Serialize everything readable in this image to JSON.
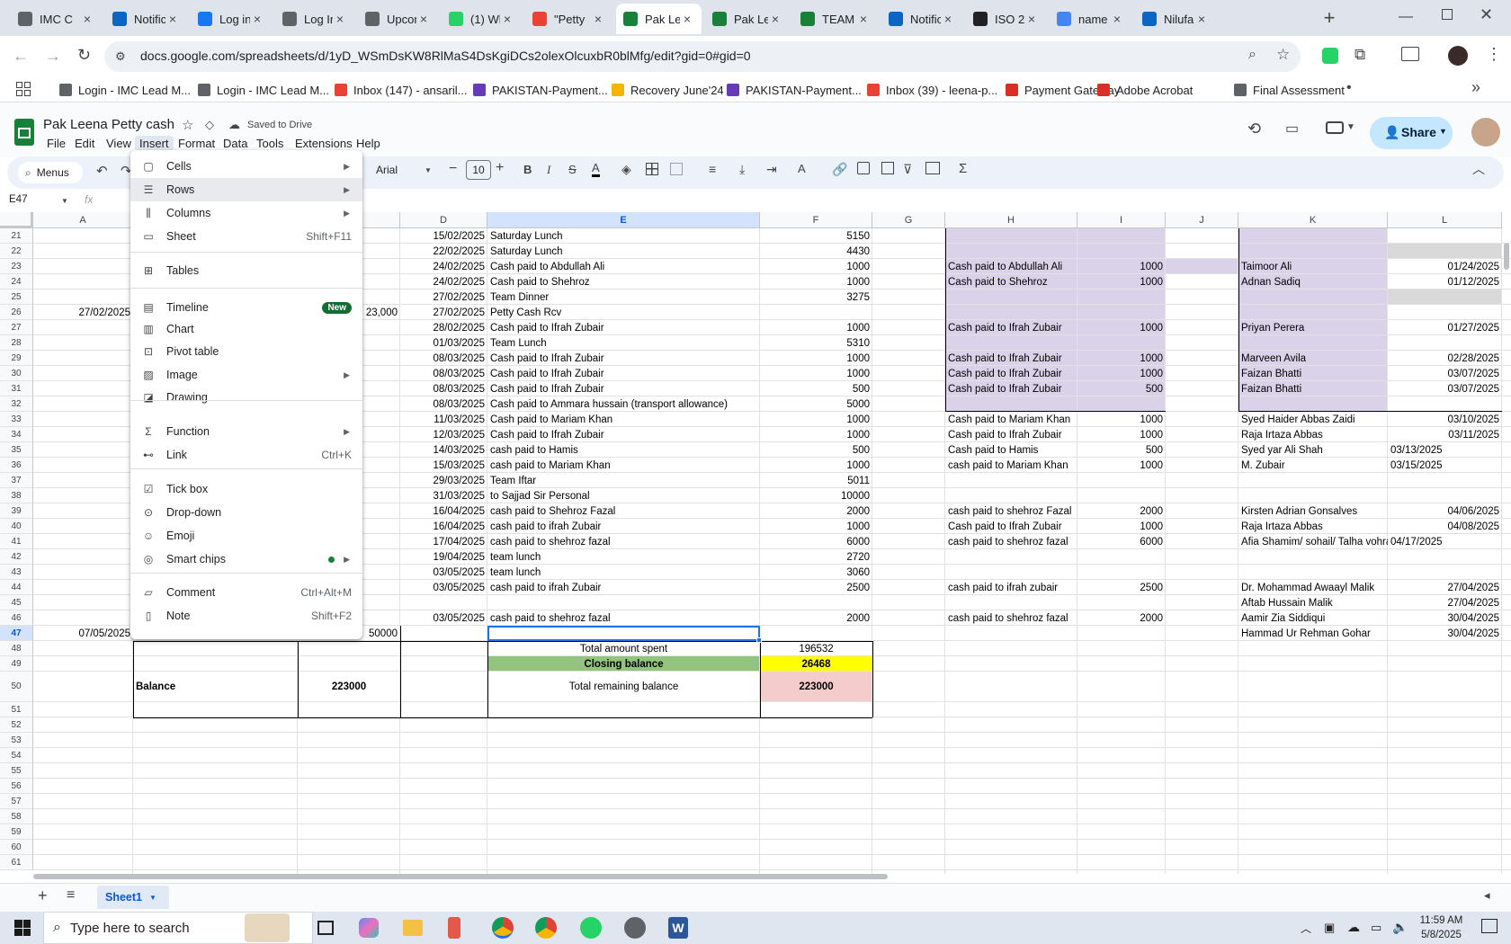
{
  "tabs": [
    {
      "label": "IMC C",
      "color": "#5f6368"
    },
    {
      "label": "Notific",
      "color": "#0a66c2"
    },
    {
      "label": "Log in",
      "color": "#1877f2"
    },
    {
      "label": "Log In",
      "color": "#5f6368"
    },
    {
      "label": "Upcon",
      "color": "#5f6368"
    },
    {
      "label": "(1) Wh",
      "color": "#25d366"
    },
    {
      "label": "\"Petty",
      "color": "#ea4335"
    },
    {
      "label": "Pak Le",
      "color": "#188038"
    },
    {
      "label": "Pak Le",
      "color": "#188038"
    },
    {
      "label": "TEAM",
      "color": "#188038"
    },
    {
      "label": "Notific",
      "color": "#0a66c2"
    },
    {
      "label": "ISO 2",
      "color": "#202124"
    },
    {
      "label": "name",
      "color": "#4285f4"
    },
    {
      "label": "Nilufa",
      "color": "#0a66c2"
    }
  ],
  "address": {
    "url": "docs.google.com/spreadsheets/d/1yD_WSmDsKW8RlMaS4DsKgiDCs2olexOlcuxbR0blMfg/edit?gid=0#gid=0"
  },
  "bookmarks": [
    {
      "label": "Login - IMC Lead M..."
    },
    {
      "label": "Login - IMC Lead M..."
    },
    {
      "label": "Inbox (147) - ansaril..."
    },
    {
      "label": "PAKISTAN-Payment..."
    },
    {
      "label": "Recovery June'24"
    },
    {
      "label": "PAKISTAN-Payment..."
    },
    {
      "label": "Inbox (39) - leena-p..."
    },
    {
      "label": "Payment Gateway"
    },
    {
      "label": "Adobe Acrobat"
    },
    {
      "label": "Final Assessment"
    }
  ],
  "sheet": {
    "title": "Pak Leena Petty cash",
    "saved_status": "Saved to Drive",
    "menus": [
      "File",
      "Edit",
      "View",
      "Insert",
      "Format",
      "Data",
      "Tools",
      "Extensions",
      "Help"
    ],
    "share_label": "Share"
  },
  "toolbar": {
    "menus_label": "Menus",
    "font": "Arial",
    "font_size": "10"
  },
  "formula": {
    "namebox": "E47",
    "fx": "fx"
  },
  "columns": [
    "A",
    "B",
    "C",
    "D",
    "E",
    "F",
    "G",
    "H",
    "I",
    "J",
    "K",
    "L"
  ],
  "rows": [
    21,
    22,
    23,
    24,
    25,
    26,
    27,
    28,
    29,
    30,
    31,
    32,
    33,
    34,
    35,
    36,
    37,
    38,
    39,
    40,
    41,
    42,
    43,
    44,
    45,
    46,
    47,
    48,
    49,
    50,
    51,
    52,
    53,
    54,
    55,
    56,
    57,
    58,
    59,
    60,
    61
  ],
  "cells": {
    "a26": "27/02/2025",
    "c26": "23,000",
    "a47": "07/05/2025",
    "c47": "50000",
    "d21": "15/02/2025",
    "d22": "22/02/2025",
    "d23": "24/02/2025",
    "d24": "24/02/2025",
    "d25": "27/02/2025",
    "d26": "27/02/2025",
    "d27": "28/02/2025",
    "d28": "01/03/2025",
    "d29": "08/03/2025",
    "d30": "08/03/2025",
    "d31": "08/03/2025",
    "d32": "08/03/2025",
    "d33": "11/03/2025",
    "d34": "12/03/2025",
    "d35": "14/03/2025",
    "d36": "15/03/2025",
    "d37": "29/03/2025",
    "d38": "31/03/2025",
    "d39": "16/04/2025",
    "d40": "16/04/2025",
    "d41": "17/04/2025",
    "d42": "19/04/2025",
    "d43": "03/05/2025",
    "d44": "03/05/2025",
    "d46": "03/05/2025",
    "e21": "Saturday Lunch",
    "e22": "Saturday Lunch",
    "e23": "Cash paid to Abdullah Ali",
    "e24": "Cash paid to Shehroz",
    "e25": "Team Dinner",
    "e26": "Petty Cash  Rcv",
    "e27": "Cash paid to Ifrah Zubair",
    "e28": "Team Lunch",
    "e29": "Cash paid to Ifrah Zubair",
    "e30": "Cash paid to Ifrah Zubair",
    "e31": "Cash paid to Ifrah Zubair",
    "e32": "Cash paid to Ammara hussain (transport allowance)",
    "e33": "Cash paid to Mariam Khan",
    "e34": "Cash paid to Ifrah Zubair",
    "e35": "cash paid to Hamis",
    "e36": "cash paid to Mariam Khan",
    "e37": "Team Iftar",
    "e38": "to Sajjad Sir Personal",
    "e39": "cash paid to Shehroz Fazal",
    "e40": "cash paid to ifrah Zubair",
    "e41": "cash paid to shehroz fazal",
    "e42": "team lunch",
    "e43": "team lunch",
    "e44": "cash paid to ifrah Zubair",
    "e46": "cash paid to shehroz fazal",
    "f21": "5150",
    "f22": "4430",
    "f23": "1000",
    "f24": "1000",
    "f25": "3275",
    "f27": "1000",
    "f28": "5310",
    "f29": "1000",
    "f30": "1000",
    "f31": "500",
    "f32": "5000",
    "f33": "1000",
    "f34": "1000",
    "f35": "500",
    "f36": "1000",
    "f37": "5011",
    "f38": "10000",
    "f39": "2000",
    "f40": "1000",
    "f41": "6000",
    "f42": "2720",
    "f43": "3060",
    "f44": "2500",
    "f46": "2000",
    "h23": "Cash paid to Abdullah Ali",
    "h24": "Cash paid to Shehroz",
    "h27": "Cash paid to Ifrah Zubair",
    "h29": "Cash paid to Ifrah Zubair",
    "h30": "Cash paid to Ifrah Zubair",
    "h31": "Cash paid to Ifrah Zubair",
    "h33": "Cash paid to Mariam Khan",
    "h34": "Cash paid to Ifrah Zubair",
    "h35": "Cash paid to Hamis",
    "h36": "cash paid to Mariam Khan",
    "h39": "cash paid to shehroz Fazal",
    "h40": "Cash paid to Ifrah Zubair",
    "h41": "cash paid to shehroz fazal",
    "h44": "cash paid to ifrah zubair",
    "h46": "cash paid to shehroz fazal",
    "i23": "1000",
    "i24": "1000",
    "i27": "1000",
    "i29": "1000",
    "i30": "1000",
    "i31": "500",
    "i33": "1000",
    "i34": "1000",
    "i35": "500",
    "i36": "1000",
    "i39": "2000",
    "i40": "1000",
    "i41": "6000",
    "i44": "2500",
    "i46": "2000",
    "k23": "Taimoor Ali",
    "k24": "Adnan Sadiq",
    "k27": "Priyan Perera",
    "k29": "Marveen Avila",
    "k30": "Faizan Bhatti",
    "k31": "Faizan Bhatti",
    "k33": "Syed Haider Abbas Zaidi",
    "k34": "Raja Irtaza Abbas",
    "k35": "Syed yar Ali Shah",
    "k36": "M. Zubair",
    "k39": "Kirsten Adrian Gonsalves",
    "k40": "Raja Irtaza Abbas",
    "k41": "Afia Shamim/ sohail/ Talha vohra",
    "k44": " Dr. Mohammad Awaayl Malik",
    "k45": "Aftab Hussain Malik",
    "k46": "Aamir Zia Siddiqui",
    "k47": "Hammad Ur Rehman Gohar",
    "l23": "01/24/2025",
    "l24": "01/12/2025",
    "l27": "01/27/2025",
    "l29": "02/28/2025",
    "l30": "03/07/2025",
    "l31": "03/07/2025",
    "l33": "03/10/2025",
    "l34": "03/11/2025",
    "l35": "03/13/2025",
    "l36": "03/15/2025",
    "l39": "04/06/2025",
    "l40": "04/08/2025",
    "l41": "04/17/2025",
    "l44": "27/04/2025",
    "l45": "27/04/2025",
    "l46": "30/04/2025",
    "l47": "30/04/2025",
    "e48": "Total amount spent",
    "f48": "196532",
    "e49": "Closing balance",
    "f49": "26468",
    "b50": "Balance",
    "c50": "223000",
    "e50": "Total remaining balance",
    "f50": "223000"
  },
  "insert_menu": [
    {
      "icon": "cells-icon",
      "label": "Cells",
      "shortcut": "",
      "arrow": true,
      "hl": false
    },
    {
      "icon": "rows-icon",
      "label": "Rows",
      "shortcut": "",
      "arrow": true,
      "hl": true
    },
    {
      "icon": "columns-icon",
      "label": "Columns",
      "shortcut": "",
      "arrow": true,
      "hl": false
    },
    {
      "icon": "sheet-icon",
      "label": "Sheet",
      "shortcut": "Shift+F11",
      "arrow": false,
      "hl": false
    },
    {
      "icon": "tables-icon",
      "label": "Tables",
      "shortcut": "",
      "arrow": false,
      "hl": false
    },
    {
      "icon": "timeline-icon",
      "label": "Timeline",
      "shortcut": "",
      "badge": "New",
      "arrow": false,
      "hl": false
    },
    {
      "icon": "chart-icon",
      "label": "Chart",
      "shortcut": "",
      "arrow": false,
      "hl": false
    },
    {
      "icon": "pivot-table-icon",
      "label": "Pivot table",
      "shortcut": "",
      "arrow": false,
      "hl": false
    },
    {
      "icon": "image-icon",
      "label": "Image",
      "shortcut": "",
      "arrow": true,
      "hl": false
    },
    {
      "icon": "drawing-icon",
      "label": "Drawing",
      "shortcut": "",
      "arrow": false,
      "hl": false
    },
    {
      "icon": "function-icon",
      "label": "Function",
      "shortcut": "",
      "arrow": true,
      "hl": false
    },
    {
      "icon": "link-icon",
      "label": "Link",
      "shortcut": "Ctrl+K",
      "arrow": false,
      "hl": false
    },
    {
      "icon": "tick-box-icon",
      "label": "Tick box",
      "shortcut": "",
      "arrow": false,
      "hl": false
    },
    {
      "icon": "drop-down-icon",
      "label": "Drop-down",
      "shortcut": "",
      "arrow": false,
      "hl": false
    },
    {
      "icon": "emoji-icon",
      "label": "Emoji",
      "shortcut": "",
      "arrow": false,
      "hl": false
    },
    {
      "icon": "smart-chips-icon",
      "label": "Smart chips",
      "shortcut": "",
      "arrow": true,
      "hl": false
    },
    {
      "icon": "comment-icon",
      "label": "Comment",
      "shortcut": "Ctrl+Alt+M",
      "arrow": false,
      "hl": false
    },
    {
      "icon": "note-icon",
      "label": "Note",
      "shortcut": "Shift+F2",
      "arrow": false,
      "hl": false
    }
  ],
  "sheet_tab": {
    "label": "Sheet1"
  },
  "taskbar": {
    "search_placeholder": "Type here to search",
    "time": "11:59 AM",
    "date": "5/8/2025"
  },
  "colors": {
    "purple": "#d9d2e9",
    "green": "#93c47d",
    "yellow": "#ffff00",
    "pink": "#f4cccc",
    "grey": "#d9d9d9",
    "accent": "#0b57d0"
  }
}
